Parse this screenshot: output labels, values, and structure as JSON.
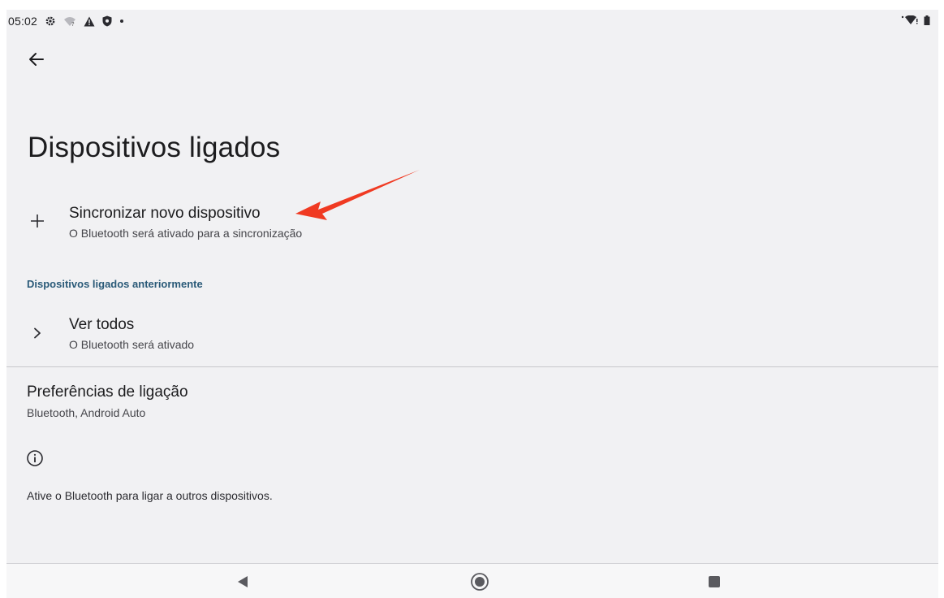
{
  "status_bar": {
    "time": "05:02",
    "left_icons": [
      "gear-icon",
      "wifi-question-icon",
      "warning-icon",
      "shield-icon",
      "dot-icon"
    ],
    "right_icons": [
      "wifi-signal-icon",
      "battery-icon"
    ]
  },
  "header": {
    "title": "Dispositivos ligados"
  },
  "pair_new": {
    "title": "Sincronizar novo dispositivo",
    "subtitle": "O Bluetooth será ativado para a sincronização"
  },
  "previous": {
    "header": "Dispositivos ligados anteriormente",
    "see_all": {
      "title": "Ver todos",
      "subtitle": "O Bluetooth será ativado"
    }
  },
  "preferences": {
    "title": "Preferências de ligação",
    "subtitle": "Bluetooth, Android Auto"
  },
  "info": {
    "text": "Ative o Bluetooth para ligar a outros dispositivos."
  },
  "colors": {
    "background": "#f1f1f3",
    "accent_header": "#2a5a78",
    "annotation_arrow": "#f03a22"
  },
  "navbar": {
    "buttons": [
      "back-triangle-icon",
      "home-circle-icon",
      "recents-square-icon"
    ]
  }
}
